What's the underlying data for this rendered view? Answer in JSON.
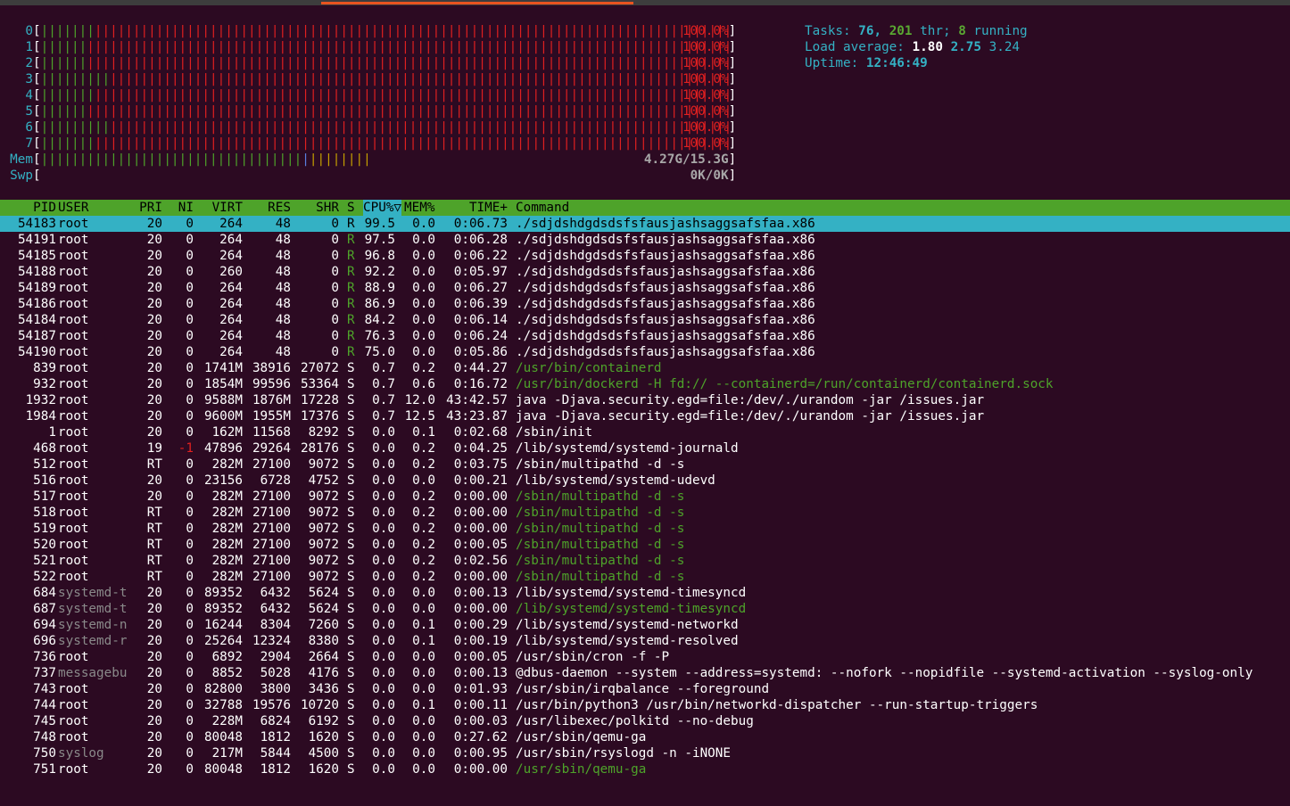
{
  "cpus": [
    {
      "label": "0",
      "percent": "100.0%",
      "green": 7,
      "red": 95
    },
    {
      "label": "1",
      "percent": "100.0%",
      "green": 6,
      "red": 96
    },
    {
      "label": "2",
      "percent": "100.0%",
      "green": 6,
      "red": 96
    },
    {
      "label": "3",
      "percent": "100.0%",
      "green": 9,
      "red": 93
    },
    {
      "label": "4",
      "percent": "100.0%",
      "green": 7,
      "red": 95
    },
    {
      "label": "5",
      "percent": "100.0%",
      "green": 6,
      "red": 96
    },
    {
      "label": "6",
      "percent": "100.0%",
      "green": 9,
      "red": 93
    },
    {
      "label": "7",
      "percent": "100.0%",
      "green": 7,
      "red": 95
    }
  ],
  "mem": {
    "label": "Mem",
    "value": "4.27G/15.3G",
    "green": 34,
    "blue": 1,
    "yellow": 8
  },
  "swap": {
    "label": "Swp",
    "value": "0K/0K"
  },
  "tasks": {
    "label": "Tasks:",
    "count": "76,",
    "threads": "201",
    "thr_label": "thr;",
    "running": "8",
    "running_label": "running"
  },
  "load": {
    "label": "Load average:",
    "one": "1.80",
    "five": "2.75",
    "fifteen": "3.24"
  },
  "uptime": {
    "label": "Uptime:",
    "value": "12:46:49"
  },
  "header": {
    "pid": "PID",
    "user": "USER",
    "pri": "PRI",
    "ni": "NI",
    "virt": "VIRT",
    "res": "RES",
    "shr": "SHR",
    "s": "S",
    "cpu": "CPU%▽",
    "mem": "MEM%",
    "time": "TIME+",
    "command": "Command"
  },
  "processes": [
    {
      "pid": "54183",
      "user": "root",
      "pri": "20",
      "ni": "0",
      "virt": "264",
      "res": "48",
      "shr": "0",
      "s": "R",
      "cpu": "99.5",
      "mem": "0.0",
      "time": "0:06.73",
      "command": "./sdjdshdgdsdsfsfausjashsaggsafsfaa.x86",
      "selected": true
    },
    {
      "pid": "54191",
      "user": "root",
      "pri": "20",
      "ni": "0",
      "virt": "264",
      "res": "48",
      "shr": "0",
      "s": "R",
      "cpu": "97.5",
      "mem": "0.0",
      "time": "0:06.28",
      "command": "./sdjdshdgdsdsfsfausjashsaggsafsfaa.x86"
    },
    {
      "pid": "54185",
      "user": "root",
      "pri": "20",
      "ni": "0",
      "virt": "264",
      "res": "48",
      "shr": "0",
      "s": "R",
      "cpu": "96.8",
      "mem": "0.0",
      "time": "0:06.22",
      "command": "./sdjdshdgdsdsfsfausjashsaggsafsfaa.x86"
    },
    {
      "pid": "54188",
      "user": "root",
      "pri": "20",
      "ni": "0",
      "virt": "260",
      "res": "48",
      "shr": "0",
      "s": "R",
      "cpu": "92.2",
      "mem": "0.0",
      "time": "0:05.97",
      "command": "./sdjdshdgdsdsfsfausjashsaggsafsfaa.x86"
    },
    {
      "pid": "54189",
      "user": "root",
      "pri": "20",
      "ni": "0",
      "virt": "264",
      "res": "48",
      "shr": "0",
      "s": "R",
      "cpu": "88.9",
      "mem": "0.0",
      "time": "0:06.27",
      "command": "./sdjdshdgdsdsfsfausjashsaggsafsfaa.x86"
    },
    {
      "pid": "54186",
      "user": "root",
      "pri": "20",
      "ni": "0",
      "virt": "264",
      "res": "48",
      "shr": "0",
      "s": "R",
      "cpu": "86.9",
      "mem": "0.0",
      "time": "0:06.39",
      "command": "./sdjdshdgdsdsfsfausjashsaggsafsfaa.x86"
    },
    {
      "pid": "54184",
      "user": "root",
      "pri": "20",
      "ni": "0",
      "virt": "264",
      "res": "48",
      "shr": "0",
      "s": "R",
      "cpu": "84.2",
      "mem": "0.0",
      "time": "0:06.14",
      "command": "./sdjdshdgdsdsfsfausjashsaggsafsfaa.x86"
    },
    {
      "pid": "54187",
      "user": "root",
      "pri": "20",
      "ni": "0",
      "virt": "264",
      "res": "48",
      "shr": "0",
      "s": "R",
      "cpu": "76.3",
      "mem": "0.0",
      "time": "0:06.24",
      "command": "./sdjdshdgdsdsfsfausjashsaggsafsfaa.x86"
    },
    {
      "pid": "54190",
      "user": "root",
      "pri": "20",
      "ni": "0",
      "virt": "264",
      "res": "48",
      "shr": "0",
      "s": "R",
      "cpu": "75.0",
      "mem": "0.0",
      "time": "0:05.86",
      "command": "./sdjdshdgdsdsfsfausjashsaggsafsfaa.x86"
    },
    {
      "pid": "839",
      "user": "root",
      "pri": "20",
      "ni": "0",
      "virt": "1741M",
      "res": "38916",
      "shr": "27072",
      "s": "S",
      "cpu": "0.7",
      "mem": "0.2",
      "time": "0:44.27",
      "command": "/usr/bin/containerd",
      "thread": true
    },
    {
      "pid": "932",
      "user": "root",
      "pri": "20",
      "ni": "0",
      "virt": "1854M",
      "res": "99596",
      "shr": "53364",
      "s": "S",
      "cpu": "0.7",
      "mem": "0.6",
      "time": "0:16.72",
      "command": "/usr/bin/dockerd -H fd:// --containerd=/run/containerd/containerd.sock",
      "thread": true
    },
    {
      "pid": "1932",
      "user": "root",
      "pri": "20",
      "ni": "0",
      "virt": "9588M",
      "res": "1876M",
      "shr": "17228",
      "s": "S",
      "cpu": "0.7",
      "mem": "12.0",
      "time": "43:42.57",
      "command": "java -Djava.security.egd=file:/dev/./urandom -jar /issues.jar"
    },
    {
      "pid": "1984",
      "user": "root",
      "pri": "20",
      "ni": "0",
      "virt": "9600M",
      "res": "1955M",
      "shr": "17376",
      "s": "S",
      "cpu": "0.7",
      "mem": "12.5",
      "time": "43:23.87",
      "command": "java -Djava.security.egd=file:/dev/./urandom -jar /issues.jar"
    },
    {
      "pid": "1",
      "user": "root",
      "pri": "20",
      "ni": "0",
      "virt": "162M",
      "res": "11568",
      "shr": "8292",
      "s": "S",
      "cpu": "0.0",
      "mem": "0.1",
      "time": "0:02.68",
      "command": "/sbin/init"
    },
    {
      "pid": "468",
      "user": "root",
      "pri": "19",
      "ni": "-1",
      "virt": "47896",
      "res": "29264",
      "shr": "28176",
      "s": "S",
      "cpu": "0.0",
      "mem": "0.2",
      "time": "0:04.25",
      "command": "/lib/systemd/systemd-journald"
    },
    {
      "pid": "512",
      "user": "root",
      "pri": "RT",
      "ni": "0",
      "virt": "282M",
      "res": "27100",
      "shr": "9072",
      "s": "S",
      "cpu": "0.0",
      "mem": "0.2",
      "time": "0:03.75",
      "command": "/sbin/multipathd -d -s"
    },
    {
      "pid": "516",
      "user": "root",
      "pri": "20",
      "ni": "0",
      "virt": "23156",
      "res": "6728",
      "shr": "4752",
      "s": "S",
      "cpu": "0.0",
      "mem": "0.0",
      "time": "0:00.21",
      "command": "/lib/systemd/systemd-udevd"
    },
    {
      "pid": "517",
      "user": "root",
      "pri": "20",
      "ni": "0",
      "virt": "282M",
      "res": "27100",
      "shr": "9072",
      "s": "S",
      "cpu": "0.0",
      "mem": "0.2",
      "time": "0:00.00",
      "command": "/sbin/multipathd -d -s",
      "thread": true
    },
    {
      "pid": "518",
      "user": "root",
      "pri": "RT",
      "ni": "0",
      "virt": "282M",
      "res": "27100",
      "shr": "9072",
      "s": "S",
      "cpu": "0.0",
      "mem": "0.2",
      "time": "0:00.00",
      "command": "/sbin/multipathd -d -s",
      "thread": true
    },
    {
      "pid": "519",
      "user": "root",
      "pri": "RT",
      "ni": "0",
      "virt": "282M",
      "res": "27100",
      "shr": "9072",
      "s": "S",
      "cpu": "0.0",
      "mem": "0.2",
      "time": "0:00.00",
      "command": "/sbin/multipathd -d -s",
      "thread": true
    },
    {
      "pid": "520",
      "user": "root",
      "pri": "RT",
      "ni": "0",
      "virt": "282M",
      "res": "27100",
      "shr": "9072",
      "s": "S",
      "cpu": "0.0",
      "mem": "0.2",
      "time": "0:00.05",
      "command": "/sbin/multipathd -d -s",
      "thread": true
    },
    {
      "pid": "521",
      "user": "root",
      "pri": "RT",
      "ni": "0",
      "virt": "282M",
      "res": "27100",
      "shr": "9072",
      "s": "S",
      "cpu": "0.0",
      "mem": "0.2",
      "time": "0:02.56",
      "command": "/sbin/multipathd -d -s",
      "thread": true
    },
    {
      "pid": "522",
      "user": "root",
      "pri": "RT",
      "ni": "0",
      "virt": "282M",
      "res": "27100",
      "shr": "9072",
      "s": "S",
      "cpu": "0.0",
      "mem": "0.2",
      "time": "0:00.00",
      "command": "/sbin/multipathd -d -s",
      "thread": true
    },
    {
      "pid": "684",
      "user": "systemd-t",
      "pri": "20",
      "ni": "0",
      "virt": "89352",
      "res": "6432",
      "shr": "5624",
      "s": "S",
      "cpu": "0.0",
      "mem": "0.0",
      "time": "0:00.13",
      "command": "/lib/systemd/systemd-timesyncd",
      "dimuser": true
    },
    {
      "pid": "687",
      "user": "systemd-t",
      "pri": "20",
      "ni": "0",
      "virt": "89352",
      "res": "6432",
      "shr": "5624",
      "s": "S",
      "cpu": "0.0",
      "mem": "0.0",
      "time": "0:00.00",
      "command": "/lib/systemd/systemd-timesyncd",
      "dimuser": true,
      "thread": true
    },
    {
      "pid": "694",
      "user": "systemd-n",
      "pri": "20",
      "ni": "0",
      "virt": "16244",
      "res": "8304",
      "shr": "7260",
      "s": "S",
      "cpu": "0.0",
      "mem": "0.1",
      "time": "0:00.29",
      "command": "/lib/systemd/systemd-networkd",
      "dimuser": true
    },
    {
      "pid": "696",
      "user": "systemd-r",
      "pri": "20",
      "ni": "0",
      "virt": "25264",
      "res": "12324",
      "shr": "8380",
      "s": "S",
      "cpu": "0.0",
      "mem": "0.1",
      "time": "0:00.19",
      "command": "/lib/systemd/systemd-resolved",
      "dimuser": true
    },
    {
      "pid": "736",
      "user": "root",
      "pri": "20",
      "ni": "0",
      "virt": "6892",
      "res": "2904",
      "shr": "2664",
      "s": "S",
      "cpu": "0.0",
      "mem": "0.0",
      "time": "0:00.05",
      "command": "/usr/sbin/cron -f -P"
    },
    {
      "pid": "737",
      "user": "messagebu",
      "pri": "20",
      "ni": "0",
      "virt": "8852",
      "res": "5028",
      "shr": "4176",
      "s": "S",
      "cpu": "0.0",
      "mem": "0.0",
      "time": "0:00.13",
      "command": "@dbus-daemon --system --address=systemd: --nofork --nopidfile --systemd-activation --syslog-only",
      "dimuser": true
    },
    {
      "pid": "743",
      "user": "root",
      "pri": "20",
      "ni": "0",
      "virt": "82800",
      "res": "3800",
      "shr": "3436",
      "s": "S",
      "cpu": "0.0",
      "mem": "0.0",
      "time": "0:01.93",
      "command": "/usr/sbin/irqbalance --foreground"
    },
    {
      "pid": "744",
      "user": "root",
      "pri": "20",
      "ni": "0",
      "virt": "32788",
      "res": "19576",
      "shr": "10720",
      "s": "S",
      "cpu": "0.0",
      "mem": "0.1",
      "time": "0:00.11",
      "command": "/usr/bin/python3 /usr/bin/networkd-dispatcher --run-startup-triggers"
    },
    {
      "pid": "745",
      "user": "root",
      "pri": "20",
      "ni": "0",
      "virt": "228M",
      "res": "6824",
      "shr": "6192",
      "s": "S",
      "cpu": "0.0",
      "mem": "0.0",
      "time": "0:00.03",
      "command": "/usr/libexec/polkitd --no-debug"
    },
    {
      "pid": "748",
      "user": "root",
      "pri": "20",
      "ni": "0",
      "virt": "80048",
      "res": "1812",
      "shr": "1620",
      "s": "S",
      "cpu": "0.0",
      "mem": "0.0",
      "time": "0:27.62",
      "command": "/usr/sbin/qemu-ga"
    },
    {
      "pid": "750",
      "user": "syslog",
      "pri": "20",
      "ni": "0",
      "virt": "217M",
      "res": "5844",
      "shr": "4500",
      "s": "S",
      "cpu": "0.0",
      "mem": "0.0",
      "time": "0:00.95",
      "command": "/usr/sbin/rsyslogd -n -iNONE",
      "dimuser": true
    },
    {
      "pid": "751",
      "user": "root",
      "pri": "20",
      "ni": "0",
      "virt": "80048",
      "res": "1812",
      "shr": "1620",
      "s": "S",
      "cpu": "0.0",
      "mem": "0.0",
      "time": "0:00.00",
      "command": "/usr/sbin/qemu-ga",
      "thread": true
    }
  ],
  "colors": {
    "background": "#2c0a22",
    "accent_cyan": "#34b1c4",
    "header_green": "#4ea32a",
    "cpu_red": "#e02020",
    "tab_orange": "#e95420"
  }
}
